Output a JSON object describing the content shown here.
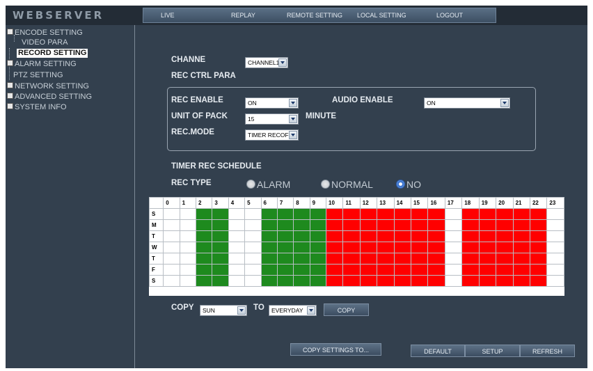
{
  "header": {
    "logo": "WEBSERVER"
  },
  "top_menu": [
    "LIVE",
    "REPLAY",
    "REMOTE SETTING",
    "LOCAL SETTING",
    "LOGOUT"
  ],
  "sidebar": {
    "encode": "ENCODE SETTING",
    "video_para": "VIDEO PARA",
    "record": "RECORD SETTING",
    "alarm": "ALARM SETTING",
    "ptz": "PTZ SETTING",
    "network": "NETWORK SETTING",
    "advanced": "ADVANCED SETTING",
    "sysinfo": "SYSTEM INFO"
  },
  "form": {
    "channel_label": "CHANNE",
    "channel_value": "CHANNEL1",
    "rec_ctrl_para": "REC CTRL PARA",
    "rec_enable_label": "REC ENABLE",
    "rec_enable_value": "ON",
    "audio_enable_label": "AUDIO ENABLE",
    "audio_enable_value": "ON",
    "unit_label": "UNIT OF PACK",
    "unit_value": "15",
    "minute": "MINUTE",
    "rec_mode_label": "REC.MODE",
    "rec_mode_value": "TIMER RECOF",
    "timer_schedule": "TIMER REC SCHEDULE",
    "rec_type_label": "REC TYPE",
    "rec_types": [
      "ALARM",
      "NORMAL",
      "NO"
    ],
    "rec_type_selected": "NO"
  },
  "schedule": {
    "hours": [
      "0",
      "1",
      "2",
      "3",
      "4",
      "5",
      "6",
      "7",
      "8",
      "9",
      "10",
      "11",
      "12",
      "13",
      "14",
      "15",
      "16",
      "17",
      "18",
      "19",
      "20",
      "21",
      "22",
      "23"
    ],
    "days": [
      "S",
      "M",
      "T",
      "W",
      "T",
      "F",
      "S"
    ],
    "hour_types": [
      "none",
      "none",
      "normal",
      "normal",
      "none",
      "none",
      "normal",
      "normal",
      "normal",
      "normal",
      "alarm",
      "alarm",
      "alarm",
      "alarm",
      "alarm",
      "alarm",
      "alarm",
      "none",
      "alarm",
      "alarm",
      "alarm",
      "alarm",
      "alarm",
      "none"
    ],
    "colors": {
      "normal": "#1e8a1e",
      "alarm": "#ff0000",
      "none": "#ffffff"
    }
  },
  "copy": {
    "label": "COPY",
    "from_value": "SUN",
    "to_label": "TO",
    "to_value": "EVERYDAY",
    "button": "COPY"
  },
  "buttons": {
    "copy_settings": "COPY SETTINGS TO...",
    "default": "DEFAULT",
    "setup": "SETUP",
    "refresh": "REFRESH"
  }
}
